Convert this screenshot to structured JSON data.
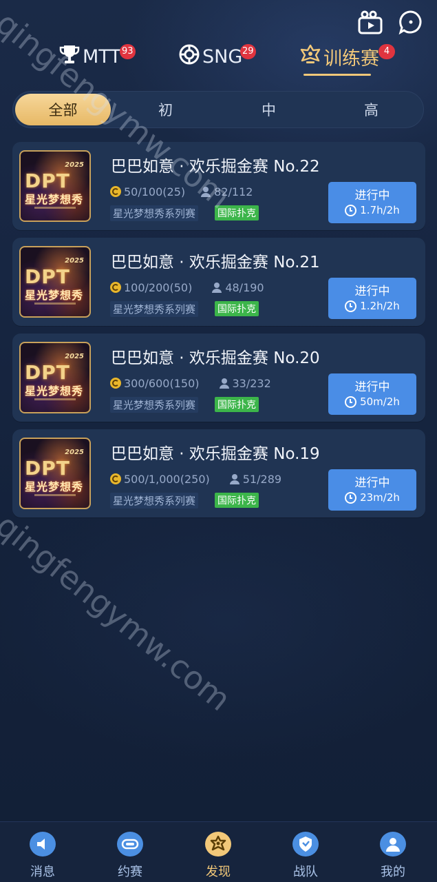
{
  "header": {
    "tabs": [
      {
        "label": "MTT",
        "badge": "93",
        "icon": "trophy-icon",
        "active": false
      },
      {
        "label": "SNG",
        "badge": "29",
        "icon": "poker-chip-icon",
        "active": false
      },
      {
        "label": "训练赛",
        "badge": "4",
        "icon": "crown-icon",
        "active": true
      }
    ],
    "right_icons": [
      "video-icon",
      "chat-bubble-icon"
    ]
  },
  "filter": {
    "options": [
      "全部",
      "初",
      "中",
      "高"
    ],
    "selected": "全部"
  },
  "tournaments": [
    {
      "title": "巴巴如意 · 欢乐掘金赛 No.22",
      "blinds": "50/100(25)",
      "players": "82/112",
      "series_tag": "星光梦想秀系列赛",
      "type_tag": "国际扑克",
      "status": "进行中",
      "time": "1.7h/2h",
      "thumb": {
        "year": "2025",
        "logo": "DPT",
        "name": "星光梦想秀"
      }
    },
    {
      "title": "巴巴如意 · 欢乐掘金赛 No.21",
      "blinds": "100/200(50)",
      "players": "48/190",
      "series_tag": "星光梦想秀系列赛",
      "type_tag": "国际扑克",
      "status": "进行中",
      "time": "1.2h/2h",
      "thumb": {
        "year": "2025",
        "logo": "DPT",
        "name": "星光梦想秀"
      }
    },
    {
      "title": "巴巴如意 · 欢乐掘金赛 No.20",
      "blinds": "300/600(150)",
      "players": "33/232",
      "series_tag": "星光梦想秀系列赛",
      "type_tag": "国际扑克",
      "status": "进行中",
      "time": "50m/2h",
      "thumb": {
        "year": "2025",
        "logo": "DPT",
        "name": "星光梦想秀"
      }
    },
    {
      "title": "巴巴如意 · 欢乐掘金赛 No.19",
      "blinds": "500/1,000(250)",
      "players": "51/289",
      "series_tag": "星光梦想秀系列赛",
      "type_tag": "国际扑克",
      "status": "进行中",
      "time": "23m/2h",
      "thumb": {
        "year": "2025",
        "logo": "DPT",
        "name": "星光梦想秀"
      }
    }
  ],
  "watermark": "qingfengymw.com",
  "bottom_nav": [
    {
      "label": "消息",
      "icon": "message-icon",
      "active": false
    },
    {
      "label": "约赛",
      "icon": "match-invite-icon",
      "active": false
    },
    {
      "label": "发现",
      "icon": "discover-icon",
      "active": true
    },
    {
      "label": "战队",
      "icon": "team-shield-icon",
      "active": false
    },
    {
      "label": "我的",
      "icon": "profile-icon",
      "active": false
    }
  ],
  "colors": {
    "accent_gold": "#f2c879",
    "button_blue": "#4a8de6",
    "tag_green": "#3cb54a",
    "badge_red": "#e0343f",
    "background": "#14223b"
  }
}
